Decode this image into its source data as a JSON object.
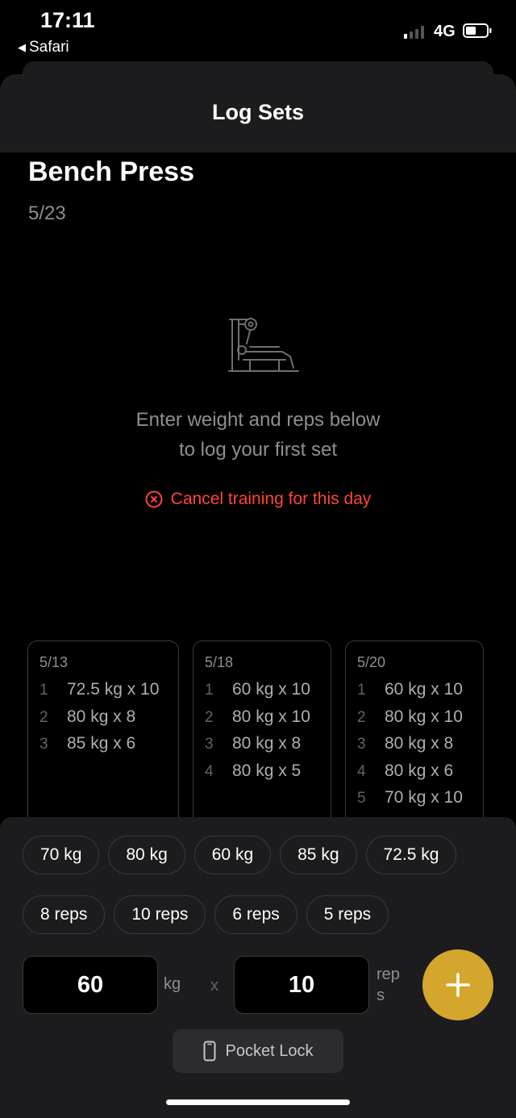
{
  "status_bar": {
    "time": "17:11",
    "back_app": "Safari",
    "network": "4G"
  },
  "header": {
    "title": "Log Sets"
  },
  "exercise": {
    "name": "Bench Press",
    "date": "5/23"
  },
  "empty_state": {
    "line1": "Enter weight and reps below",
    "line2": "to log your first set",
    "cancel_label": "Cancel training for this day",
    "icon": "bench-press-icon"
  },
  "history": [
    {
      "date": "5/13",
      "sets": [
        {
          "n": "1",
          "text": "72.5 kg x 10"
        },
        {
          "n": "2",
          "text": "80 kg x 8"
        },
        {
          "n": "3",
          "text": "85 kg x 6"
        }
      ]
    },
    {
      "date": "5/18",
      "sets": [
        {
          "n": "1",
          "text": "60 kg x 10"
        },
        {
          "n": "2",
          "text": "80 kg x 10"
        },
        {
          "n": "3",
          "text": "80 kg x 8"
        },
        {
          "n": "4",
          "text": "80 kg x 5"
        }
      ]
    },
    {
      "date": "5/20",
      "sets": [
        {
          "n": "1",
          "text": "60 kg x 10"
        },
        {
          "n": "2",
          "text": "80 kg x 10"
        },
        {
          "n": "3",
          "text": "80 kg x 8"
        },
        {
          "n": "4",
          "text": "80 kg x 6"
        },
        {
          "n": "5",
          "text": "70 kg x 10"
        }
      ]
    }
  ],
  "weight_chips": [
    "70 kg",
    "80 kg",
    "60 kg",
    "85 kg",
    "72.5 kg"
  ],
  "rep_chips": [
    "8 reps",
    "10 reps",
    "6 reps",
    "5 reps"
  ],
  "entry": {
    "weight": "60",
    "weight_unit": "kg",
    "times": "x",
    "reps": "10",
    "reps_unit_line1": "rep",
    "reps_unit_line2": "s"
  },
  "add_button": {
    "icon": "plus-icon"
  },
  "pocket_lock": {
    "label": "Pocket Lock",
    "icon": "phone-icon"
  },
  "colors": {
    "accent": "#d4a72c",
    "danger": "#ff453a",
    "background": "#000000",
    "panel": "#1c1c1e"
  }
}
